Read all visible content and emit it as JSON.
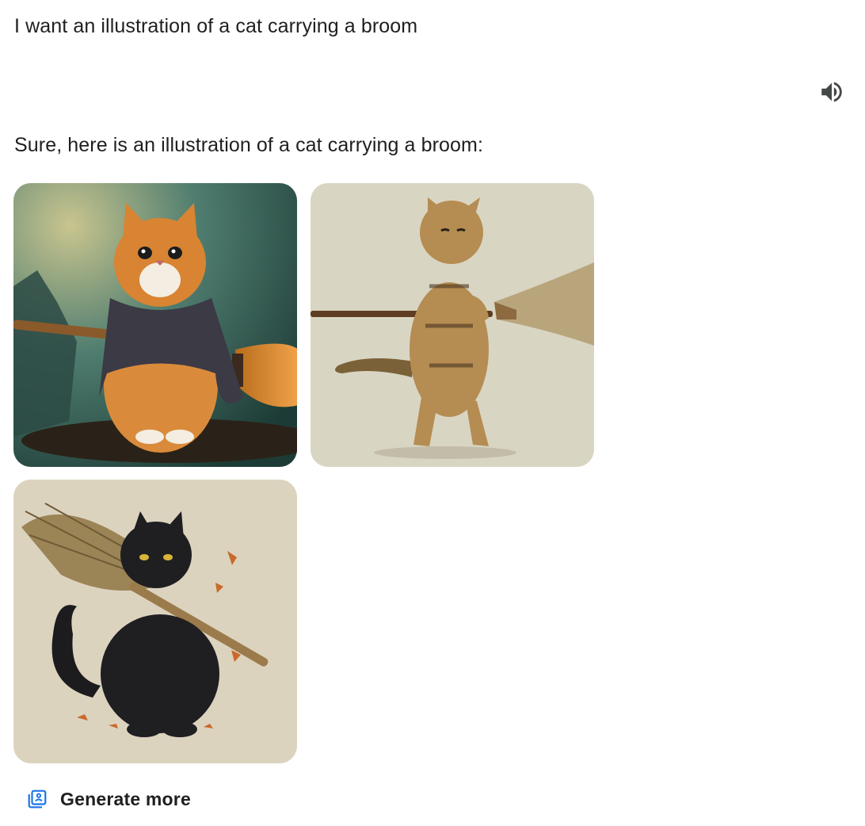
{
  "conversation": {
    "user_prompt": "I want an illustration of a cat carrying a broom",
    "response_text": "Sure, here is an illustration of a cat carrying a broom:"
  },
  "toolbar": {
    "speaker_icon": "volume-up-icon"
  },
  "images": [
    {
      "subject": "ginger-cat-with-scarf-and-broom",
      "background": "#3f6b62"
    },
    {
      "subject": "tabby-cat-standing-holding-broom",
      "background": "#d9d5c3"
    },
    {
      "subject": "black-cat-carrying-broom-on-shoulder",
      "background": "#dcd3bf"
    }
  ],
  "actions": {
    "generate_more_label": "Generate more",
    "generate_more_icon": "image-stack-icon",
    "accent_color": "#1a73e8"
  }
}
